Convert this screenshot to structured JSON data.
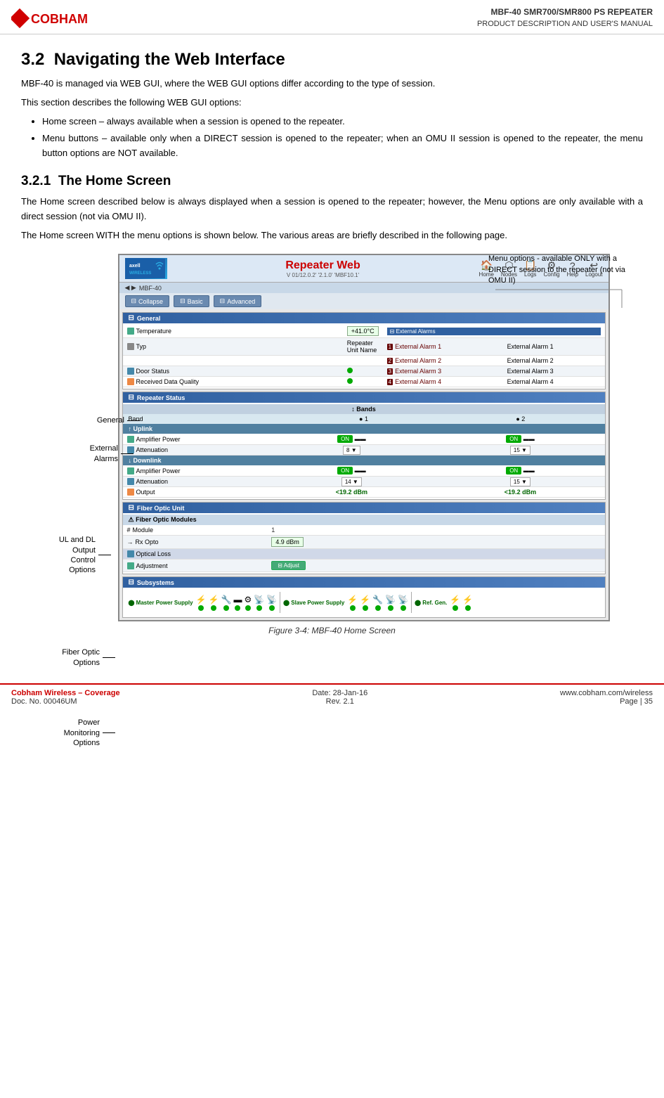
{
  "header": {
    "logo_text": "COBHAM",
    "doc_title": "MBF-40 SMR700/SMR800 PS REPEATER",
    "doc_subtitle": "PRODUCT DESCRIPTION AND USER'S MANUAL"
  },
  "section": {
    "number": "3.2",
    "title": "Navigating the Web Interface",
    "intro1": "MBF-40 is managed via WEB GUI, where the WEB GUI options differ according to the type of session.",
    "intro2": "This section describes the following WEB GUI options:",
    "bullets": [
      "Home screen – always available when a session is opened to the repeater.",
      "Menu buttons – available only when a DIRECT session is opened to the repeater; when an OMU II session is opened to the repeater, the menu button options are NOT available."
    ],
    "subsection_number": "3.2.1",
    "subsection_title": "The Home Screen",
    "sub_para1": "The Home screen described below is always displayed when a session is opened to the repeater; however, the Menu options are only available with a direct session (not via OMU II).",
    "sub_para2": "The Home screen WITH the menu options is shown below. The various areas are briefly described in the following page."
  },
  "callout": {
    "text": "Menu options - available ONLY with a DIRECT session to the repeater (not via OMU II)"
  },
  "annotations": [
    {
      "id": "general",
      "label": "General",
      "top_pct": 32
    },
    {
      "id": "external-alarms",
      "label": "External\nAlarms",
      "top_pct": 38
    },
    {
      "id": "ul-dl",
      "label": "UL and DL\nOutput\nControl\nOptions",
      "top_pct": 55
    },
    {
      "id": "fiber-optic",
      "label": "Fiber Optic\nOptions",
      "top_pct": 72
    },
    {
      "id": "power-monitoring",
      "label": "Power\nMonitoring\nOptions",
      "top_pct": 84
    }
  ],
  "gui": {
    "title": "Repeater Web",
    "version": "V 01/12.0.2' '2.1.0' 'MBF10.1'",
    "breadcrumb": "MBF-40",
    "nav_items": [
      {
        "label": "Home",
        "icon": "🏠"
      },
      {
        "label": "Nodes",
        "icon": "⬡"
      },
      {
        "label": "Logs",
        "icon": "📋"
      },
      {
        "label": "Config",
        "icon": "⚙"
      },
      {
        "label": "Help",
        "icon": "?"
      },
      {
        "label": "Logout",
        "icon": "↩"
      }
    ],
    "toolbar_buttons": [
      "Collapse",
      "Basic",
      "Advanced"
    ],
    "sections": [
      {
        "id": "general",
        "title": "General",
        "rows": [
          {
            "label": "Temperature",
            "col1_val": "+41.0°C",
            "has_col2": true,
            "col2_label": "External Alarms",
            "col2_val": ""
          },
          {
            "label": "Typ",
            "col1_val": "Repeater Unit Name",
            "has_col2": true,
            "col2_label": "External Alarm 1",
            "col2_val": "External Alarm 1"
          },
          {
            "label": "",
            "col1_val": "",
            "has_col2": true,
            "col2_label": "External Alarm 2",
            "col2_val": "External Alarm 2"
          },
          {
            "label": "Door Status",
            "col1_val": "",
            "has_col2": true,
            "col2_label": "External Alarm 3",
            "col2_val": "External Alarm 3"
          },
          {
            "label": "Received Data Quality",
            "col1_val": "",
            "has_col2": true,
            "col2_label": "External Alarm 4",
            "col2_val": "External Alarm 4"
          }
        ]
      },
      {
        "id": "repeater-status",
        "title": "Repeater Status",
        "has_bands": true,
        "band_cols": [
          "1",
          "2"
        ],
        "uplink": {
          "title": "Uplink",
          "rows": [
            {
              "label": "Amplifier Power",
              "col1_val": "ON",
              "col2_val": "ON"
            },
            {
              "label": "Attenuation",
              "col1_val": "8",
              "col2_val": "15"
            }
          ]
        },
        "downlink": {
          "title": "Downlink",
          "rows": [
            {
              "label": "Amplifier Power",
              "col1_val": "ON",
              "col2_val": "ON"
            },
            {
              "label": "Attenuation",
              "col1_val": "14",
              "col2_val": "15"
            },
            {
              "label": "Output",
              "col1_val": "<19.2 dBm",
              "col2_val": "<19.2 dBm"
            }
          ]
        }
      },
      {
        "id": "fiber-optic",
        "title": "Fiber Optic Unit",
        "sub_header": "Fiber Optic Modules",
        "rows": [
          {
            "label": "#",
            "col1_label": "Module",
            "col1_val": "1"
          },
          {
            "label": "→",
            "col1_label": "Rx Opto",
            "col1_val": "4.9 dBm"
          },
          {
            "label": "",
            "col1_label": "Optical Loss",
            "col1_val": ""
          },
          {
            "label": "",
            "col1_label": "Adjustment",
            "col1_val": "Adjust"
          }
        ]
      },
      {
        "id": "subsystems",
        "title": "Subsystems",
        "power_labels": [
          "Master Power Supply",
          "Slave Power Supply",
          "Ref. Gen."
        ]
      }
    ]
  },
  "figure_caption": "Figure 3-4:  MBF-40 Home Screen",
  "footer": {
    "company": "Cobham Wireless – Coverage",
    "doc_number": "Doc. No. 00046UM",
    "date": "Date: 28-Jan-16",
    "rev": "Rev. 2.1",
    "website": "www.cobham.com/wireless",
    "page": "Page | 35"
  }
}
